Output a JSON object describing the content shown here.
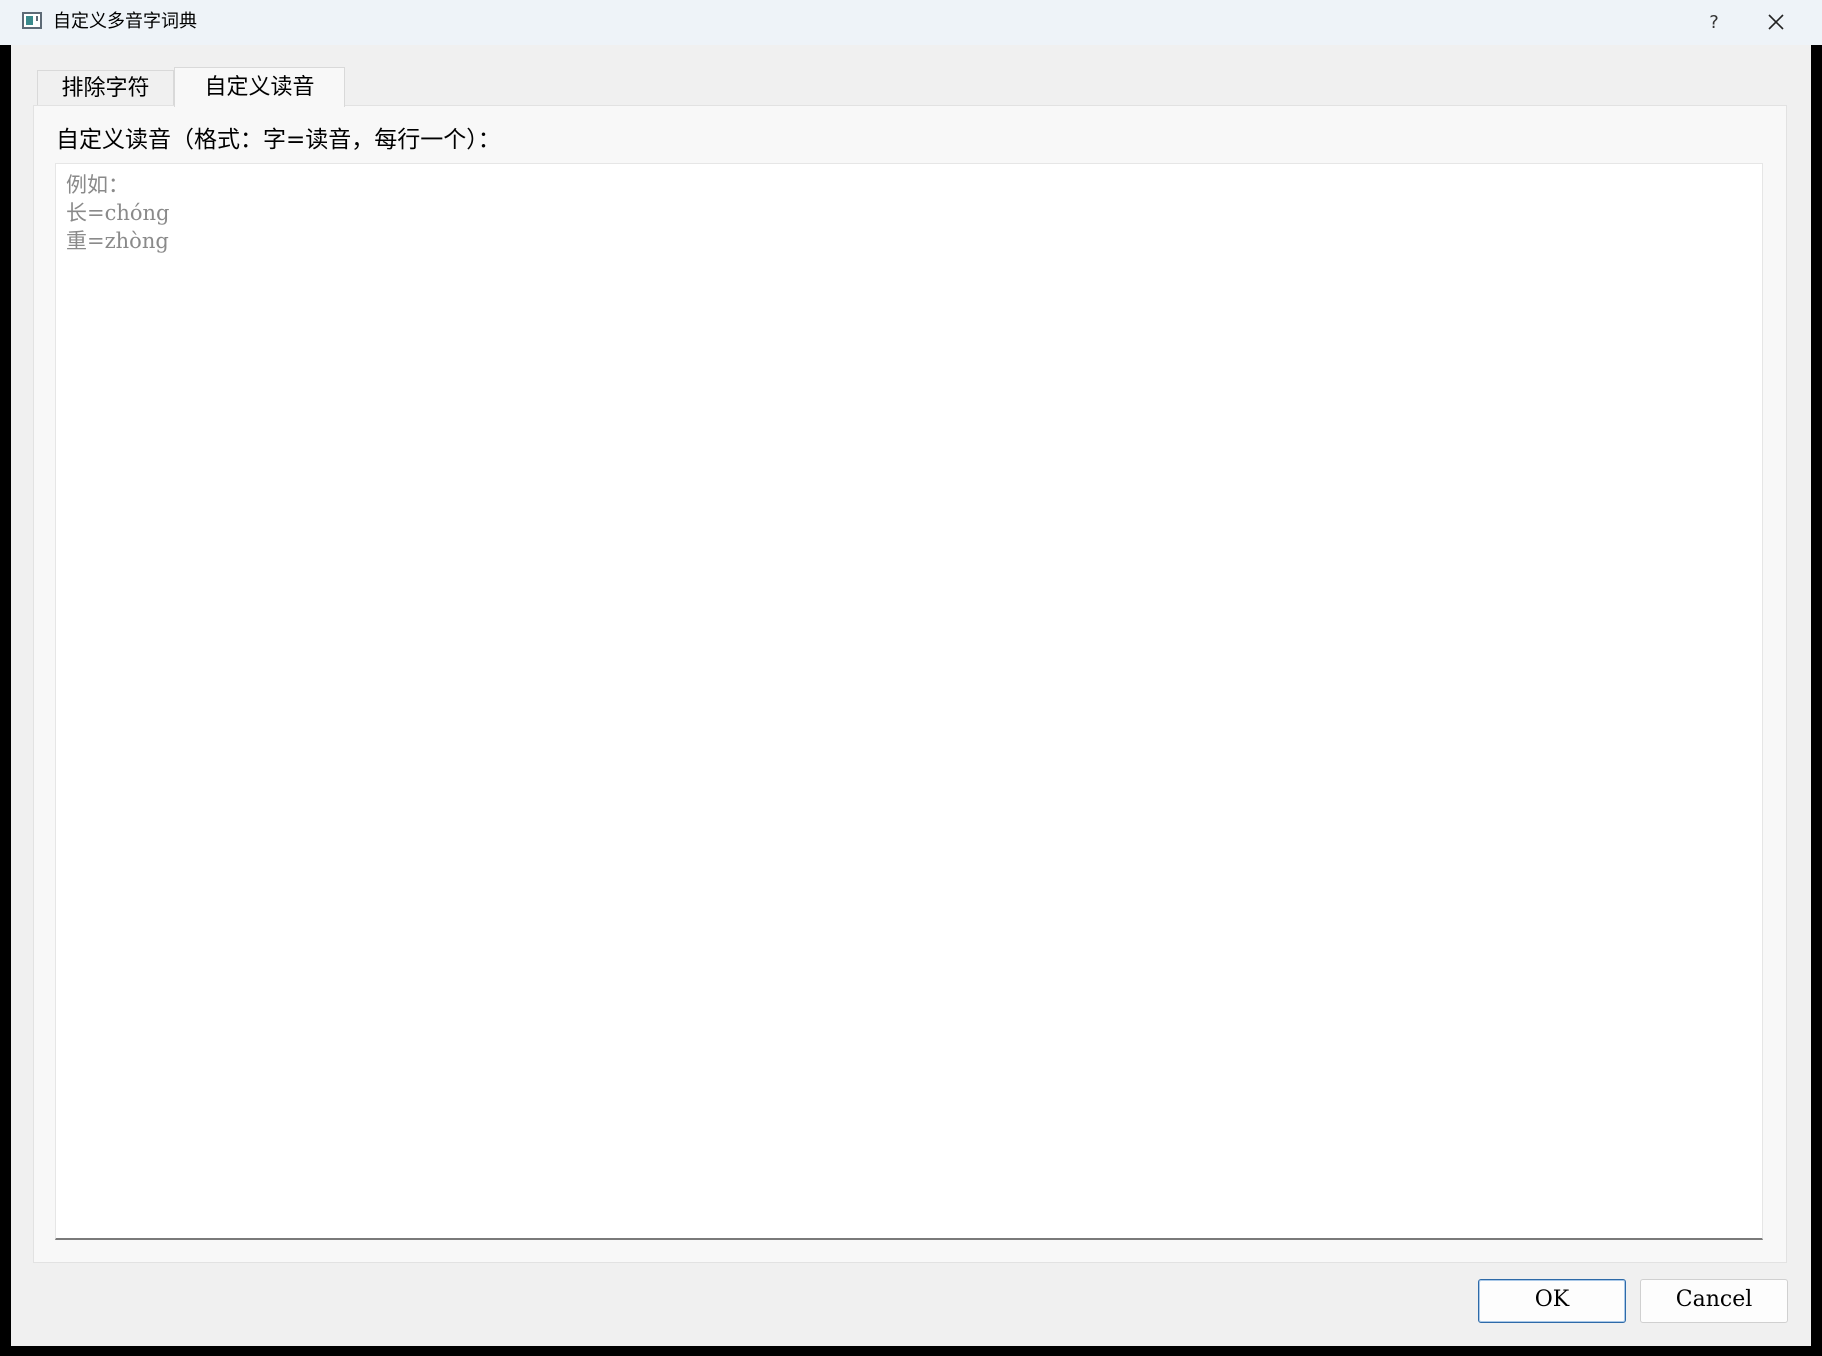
{
  "window": {
    "title": "自定义多音字词典",
    "help_label": "?"
  },
  "tabs": [
    {
      "label": "排除字符",
      "active": false
    },
    {
      "label": "自定义读音",
      "active": true
    }
  ],
  "custom_reading": {
    "label": "自定义读音（格式：字=读音，每行一个）：",
    "value": "",
    "placeholder_lines": [
      "例如：",
      "长=chóng",
      "重=zhòng"
    ]
  },
  "buttons": {
    "ok_label": "OK",
    "cancel_label": "Cancel"
  },
  "icons": {
    "app": "window-app-icon",
    "close": "close-icon"
  },
  "colors": {
    "titlebar_bg": "#eef3f8",
    "dialog_bg": "#f0f0f0",
    "default_button_border": "#2e6aa8",
    "placeholder_text": "#8a8a8a"
  }
}
